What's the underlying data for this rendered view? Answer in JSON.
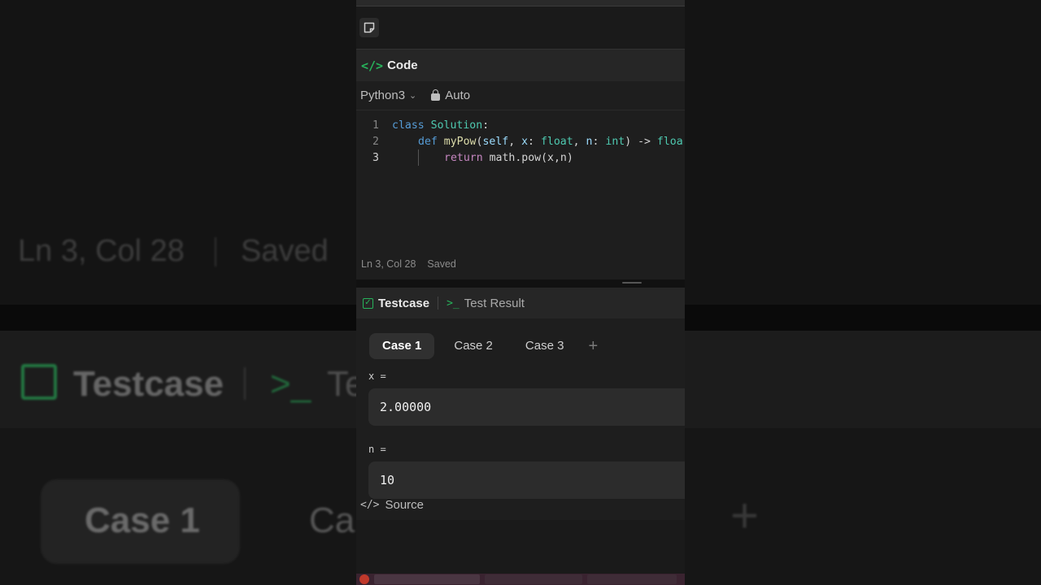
{
  "background": {
    "status_text": "Ln 3, Col 28",
    "saved_text": "Saved",
    "testcase_text": "Testcase",
    "test_partial": "Te",
    "case1_text": "Case 1",
    "case_partial": "Ca",
    "plus_text": "+"
  },
  "code_panel": {
    "title": "Code",
    "language": "Python3",
    "mode": "Auto",
    "lines": [
      {
        "num": "1"
      },
      {
        "num": "2"
      },
      {
        "num": "3"
      }
    ],
    "line1": {
      "kw": "class",
      "name": "Solution",
      "rest": ":"
    },
    "line2": {
      "kw": "def",
      "fn": "myPow",
      "open": "(",
      "self": "self",
      "c1": ", ",
      "x": "x",
      "c2": ": ",
      "t1": "float",
      "c3": ", ",
      "n": "n",
      "c4": ": ",
      "t2": "int",
      "c5": ") -> ",
      "t3": "floa"
    },
    "line3": {
      "kw": "return",
      "expr": "math.pow(x,n)"
    },
    "status": {
      "position": "Ln 3, Col 28",
      "saved": "Saved"
    }
  },
  "test_panel": {
    "tab_active": "Testcase",
    "tab_inactive": "Test Result",
    "cases": [
      "Case 1",
      "Case 2",
      "Case 3"
    ],
    "add_label": "+",
    "vars": [
      {
        "label": "x =",
        "value": "2.00000"
      },
      {
        "label": "n =",
        "value": "10"
      }
    ],
    "source_label": "Source"
  },
  "colors": {
    "accent_green": "#27b35b",
    "editor_bg": "#1e1e1e",
    "keyword": "#569cd6",
    "class_name": "#4ec9b0",
    "function": "#dcdcaa"
  }
}
